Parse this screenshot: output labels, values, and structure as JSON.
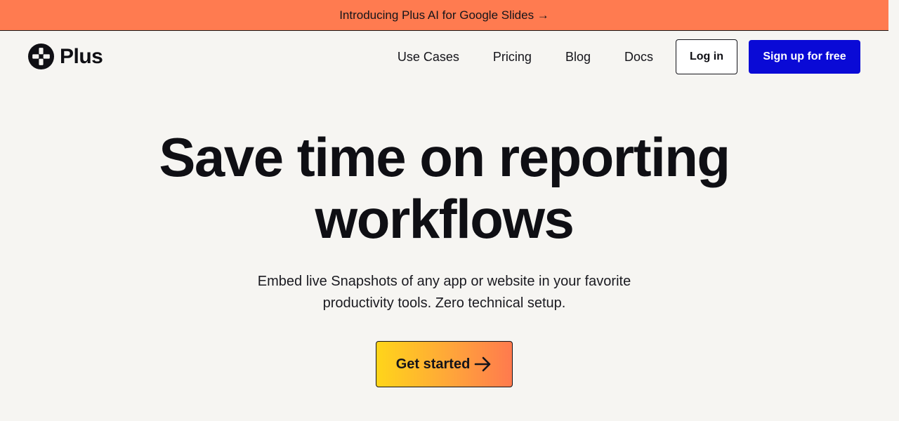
{
  "announcement": {
    "text": "Introducing Plus AI for Google Slides →"
  },
  "brand": {
    "name": "Plus",
    "icon": "plus-logo-icon"
  },
  "nav": {
    "links": [
      "Use Cases",
      "Pricing",
      "Blog",
      "Docs"
    ],
    "login_label": "Log in",
    "signup_label": "Sign up for free"
  },
  "hero": {
    "headline_line1": "Save time on reporting",
    "headline_line2": "workflows",
    "subhead_line1": "Embed live Snapshots of any app or website in your favorite",
    "subhead_line2": "productivity tools. Zero technical setup.",
    "cta_label": "Get started",
    "cta_icon": "arrow-right-icon"
  },
  "colors": {
    "background": "#f6f5f2",
    "announcement_bg": "#ff7b50",
    "signup_bg": "#0a0ad6",
    "cta_gradient_start": "#ffd51a",
    "cta_gradient_end": "#ff7a4e",
    "text": "#0f0f14"
  }
}
